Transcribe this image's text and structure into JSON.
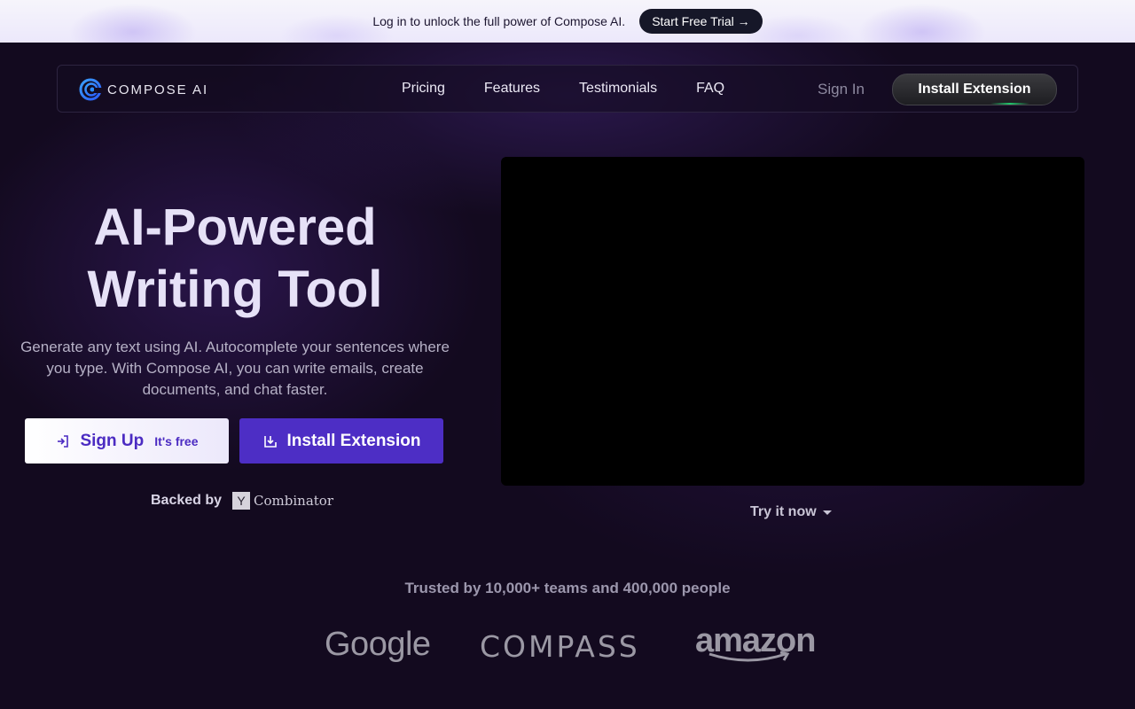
{
  "banner": {
    "text": "Log in to unlock the full power of Compose AI.",
    "button": "Start Free Trial →"
  },
  "nav": {
    "logo_text": "COMPOSE AI",
    "links": [
      "Pricing",
      "Features",
      "Testimonials",
      "FAQ"
    ],
    "sign_in": "Sign In",
    "install": "Install Extension"
  },
  "hero": {
    "title_line1": "AI-Powered",
    "title_line2": "Writing Tool",
    "subtitle": "Generate any text using AI. Autocomplete your sentences where you type. With Compose AI, you can write emails, create documents, and chat faster.",
    "signup_label": "Sign Up",
    "signup_note": "It's free",
    "install_label": "Install Extension",
    "backed_by": "Backed by",
    "yc_letter": "Y",
    "yc_text": "Combinator"
  },
  "video": {
    "try_now": "Try it now"
  },
  "trusted": {
    "text": "Trusted by 10,000+ teams and 400,000 people",
    "brands": [
      "Google",
      "COMPASS",
      "amazon"
    ]
  },
  "colors": {
    "background": "#130a1f",
    "accent_purple": "#4d2ec5",
    "banner_button": "#161728"
  }
}
